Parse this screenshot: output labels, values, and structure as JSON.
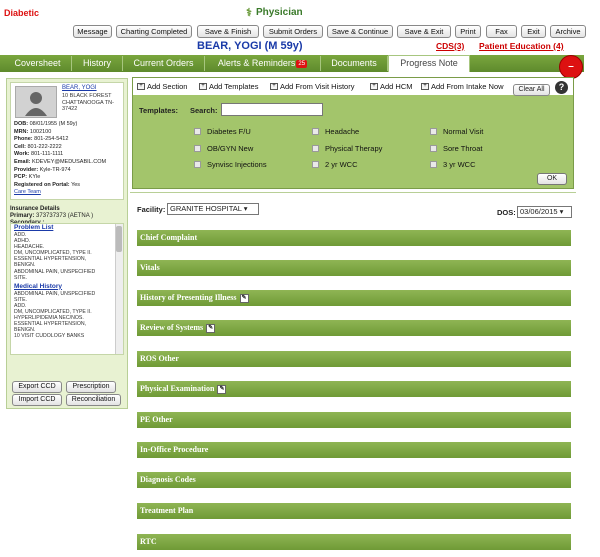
{
  "header": {
    "condition": "Diabetic",
    "module_title": "Physician"
  },
  "toolbar": {
    "message": "Message",
    "charting_completed": "Charting Completed",
    "save_finish": "Save & Finish",
    "submit_orders": "Submit Orders",
    "save_continue": "Save & Continue",
    "save_exit": "Save & Exit",
    "print": "Print",
    "fax": "Fax",
    "exit": "Exit",
    "archive": "Archive"
  },
  "patient": {
    "name_age": "BEAR, YOGI (M 59y)",
    "cds": "CDS(3)",
    "patient_education": "Patient Education (4)"
  },
  "tabs": [
    {
      "label": "Coversheet"
    },
    {
      "label": "History"
    },
    {
      "label": "Current Orders"
    },
    {
      "label": "Alerts & Reminders"
    },
    {
      "label": "Documents"
    },
    {
      "label": "Progress Note"
    }
  ],
  "alerts_badge": "25",
  "patient_card": {
    "link_name": "BEAR, YOGI",
    "addr1": "10 BLACK FOREST",
    "addr2": "CHATTANOOGA TN-",
    "addr3": "37422",
    "dob_label": "DOB:",
    "dob": "08/01/1955 (M 59y)",
    "mrn_label": "MRN:",
    "mrn": "1002100",
    "phone_label": "Phone:",
    "phone": "801-254-5412",
    "cell_label": "Cell:",
    "cell": "801-222-2222",
    "work_label": "Work:",
    "work": "801-111-1111",
    "email_label": "Email:",
    "email": "KDEVEY@MEDUSABIL.COM",
    "provider_label": "Provider:",
    "provider": "Kyle-TR-974",
    "pcp_label": "PCP:",
    "pcp": "KYle",
    "portal_label": "Registered on Portal:",
    "portal": "Yes",
    "care_team": "Care Team"
  },
  "insurance": {
    "title": "Insurance Details",
    "primary_label": "Primary:",
    "primary": "373737373 (AETNA )",
    "secondary_label": "Secondary :",
    "secondary": ""
  },
  "problem_list": {
    "title": "Problem List",
    "items": [
      "ADD.",
      "ADHD.",
      "HEADACHE.",
      "DM, UNCOMPLICATED, TYPE II.",
      "ESSENTIAL HYPERTENSION,",
      "BENIGN.",
      "ABDOMINAL PAIN, UNSPECIFIED",
      "SITE."
    ]
  },
  "medical_history": {
    "title": "Medical History",
    "items": [
      "ABDOMINAL PAIN, UNSPECIFIED",
      "SITE.",
      "ADD.",
      "DM, UNCOMPLICATED, TYPE II.",
      "HYPERLIPIDEMIA NEC/NOS.",
      "ESSENTIAL HYPERTENSION,",
      "BENIGN.",
      "10 VISIT CUDOLOGY BANKS"
    ]
  },
  "left_buttons": {
    "export_ccd": "Export CCD",
    "prescription": "Prescription",
    "import_ccd": "Import CCD",
    "reconciliation": "Reconciliation"
  },
  "template_actions": {
    "add_section": "Add Section",
    "add_templates": "Add Templates",
    "add_from_visit": "Add From Visit History",
    "add_hcm": "Add HCM",
    "add_from_intake": "Add From Intake Now",
    "clear_all": "Clear All",
    "help": "?"
  },
  "templates": {
    "label": "Templates:",
    "search_label": "Search:",
    "search_value": "",
    "ok": "OK",
    "options": [
      "Diabetes F/U",
      "Headache",
      "Normal Visit",
      "OB/GYN New",
      "Physical Therapy",
      "Sore Throat",
      "Synvisc Injections",
      "2 yr WCC",
      "3 yr WCC"
    ]
  },
  "facility": {
    "label": "Facility:",
    "value": "GRANITE HOSPITAL"
  },
  "dos": {
    "label": "DOS:",
    "value": "03/06/2015"
  },
  "sections": [
    "Chief Complaint",
    "Vitals",
    "History of Presenting Illness",
    "Review of Systems",
    "ROS Other",
    "Physical Examination",
    "PE Other",
    "In-Office Procedure",
    "Diagnosis Codes",
    "Treatment Plan",
    "RTC"
  ]
}
